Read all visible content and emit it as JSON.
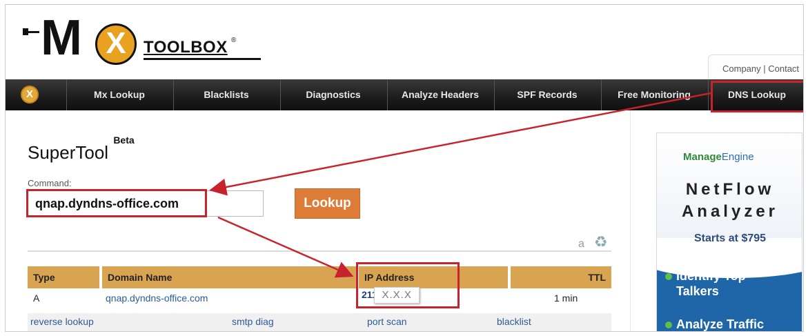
{
  "logo": {
    "m": "M",
    "x": "X",
    "toolbox": "TOOLBOX",
    "reg": "®"
  },
  "toplinks": "Company | Contact",
  "nav": {
    "home_icon": "X",
    "items": [
      "Mx Lookup",
      "Blacklists",
      "Diagnostics",
      "Analyze Headers",
      "SPF Records",
      "Free Monitoring",
      "DNS Lookup"
    ]
  },
  "supertool": {
    "title": "SuperTool",
    "beta": "Beta",
    "command_label": "Command:",
    "command_value": "qnap.dyndns-office.com",
    "lookup_button": "Lookup",
    "a_label": "a",
    "recycle_icon": "♻"
  },
  "table": {
    "headers": [
      "Type",
      "Domain Name",
      "IP Address",
      "TTL"
    ],
    "row": {
      "type": "A",
      "domain": "qnap.dyndns-office.com",
      "ip": "211.",
      "ip_masked": "X.X.X",
      "ttl": "1 min"
    },
    "actions": [
      "reverse lookup",
      "smtp diag",
      "port scan",
      "blacklist"
    ]
  },
  "ad": {
    "brand_main": "Manage",
    "brand_sub": "Engine",
    "line1": "NetFlow",
    "line2": "Analyzer",
    "price": "Starts at $795",
    "bullet1_line1": "Identify Top",
    "bullet1_line2": "Talkers",
    "bullet2": "Analyze Traffic"
  },
  "colors": {
    "annotation": "#c8232c",
    "lookup_button": "#dc7c37",
    "table_header": "#d8a451",
    "ad_blue": "#1e66a8"
  }
}
